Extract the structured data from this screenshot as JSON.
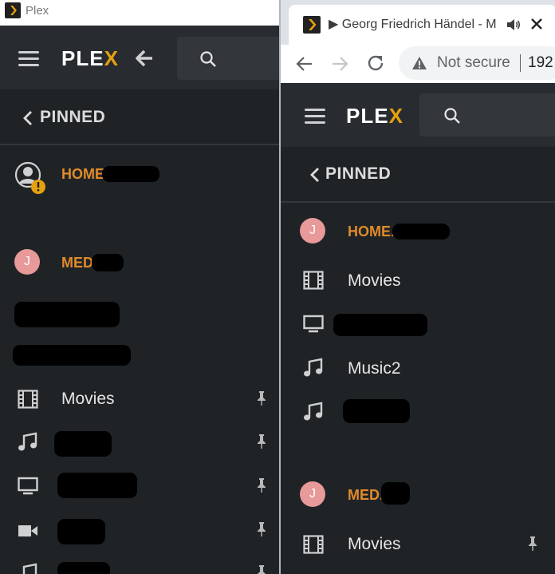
{
  "left_window": {
    "title": "Plex",
    "logo": {
      "text": "PLE",
      "accent": "X"
    },
    "pinned_label": "PINNED",
    "servers": [
      {
        "label": "HOME",
        "icon": "user-warning-icon"
      },
      {
        "label": "MED",
        "avatar": "J"
      }
    ],
    "libraries": [
      {
        "label": "Movies",
        "icon": "film-icon",
        "pinned": true
      },
      {
        "label": "",
        "icon": "music-icon",
        "pinned": true
      },
      {
        "label": "",
        "icon": "tv-icon",
        "pinned": true
      },
      {
        "label": "",
        "icon": "video-camera-icon",
        "pinned": true
      }
    ]
  },
  "right_window": {
    "tab": {
      "title": "▶ Georg Friedrich Händel - M",
      "audio_icon": "speaker-icon"
    },
    "omnibox": {
      "security_text": "Not secure",
      "url": "192"
    },
    "logo": {
      "text": "PLE",
      "accent": "X"
    },
    "pinned_label": "PINNED",
    "servers": [
      {
        "label": "HOME.",
        "avatar": "J",
        "libraries": [
          {
            "label": "Movies",
            "icon": "film-icon"
          },
          {
            "label": "",
            "icon": "tv-icon"
          },
          {
            "label": "Music2",
            "icon": "music-icon"
          },
          {
            "label": "",
            "icon": "music-icon"
          }
        ]
      },
      {
        "label": "MED.",
        "avatar": "J",
        "libraries": [
          {
            "label": "Movies",
            "icon": "film-icon",
            "pinned": true
          }
        ]
      }
    ]
  },
  "colors": {
    "background": "#1f2326",
    "topbar": "#282c30",
    "accent": "#e5a00d",
    "server_label": "#e08a2a",
    "avatar": "#e89999",
    "warning": "#e5a00d"
  }
}
